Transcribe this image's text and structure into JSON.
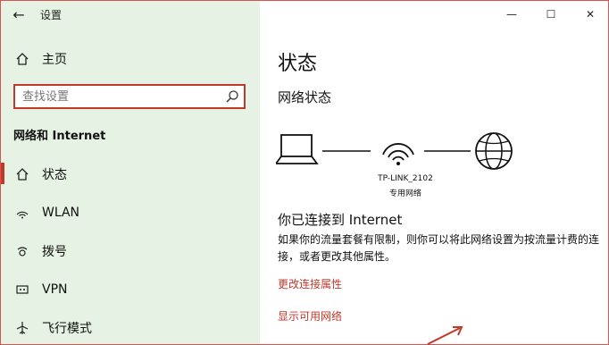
{
  "window": {
    "title": "设置",
    "controls": {
      "minimize": "—",
      "maximize": "☐",
      "close": "✕"
    }
  },
  "sidebar": {
    "back": "←",
    "home_label": "主页",
    "search_placeholder": "查找设置",
    "section_title": "网络和 Internet",
    "items": [
      {
        "label": "状态",
        "icon": "home-icon"
      },
      {
        "label": "WLAN",
        "icon": "wifi-icon"
      },
      {
        "label": "拨号",
        "icon": "dialup-icon"
      },
      {
        "label": "VPN",
        "icon": "vpn-icon"
      },
      {
        "label": "飞行模式",
        "icon": "airplane-icon"
      }
    ],
    "active_index": 0
  },
  "main": {
    "title": "状态",
    "network_status_title": "网络状态",
    "network_name": "TP-LINK_2102",
    "network_type": "专用网络",
    "connected_title": "你已连接到 Internet",
    "description": "如果你的流量套餐有限制，则你可以将此网络设置为按流量计费的连接，或者更改其他属性。",
    "links": {
      "change_properties": "更改连接属性",
      "show_networks": "显示可用网络"
    }
  },
  "colors": {
    "accent": "#c0392b",
    "sidebar_bg": "#e6f2e3"
  }
}
